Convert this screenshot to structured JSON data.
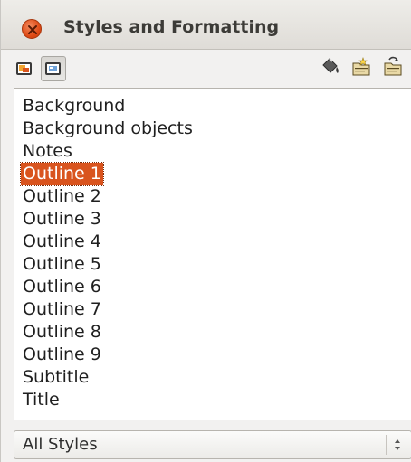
{
  "window": {
    "title": "Styles and Formatting"
  },
  "toolbar": {
    "left_buttons": [
      {
        "icon": "graphics-styles-icon",
        "pressed": false
      },
      {
        "icon": "presentation-styles-icon",
        "pressed": true
      }
    ],
    "right_buttons": [
      {
        "icon": "fill-format-mode-icon"
      },
      {
        "icon": "new-style-from-selection-icon"
      },
      {
        "icon": "update-style-icon"
      }
    ]
  },
  "styles_list": {
    "items": [
      {
        "label": "Background",
        "selected": false
      },
      {
        "label": "Background objects",
        "selected": false
      },
      {
        "label": "Notes",
        "selected": false
      },
      {
        "label": "Outline 1",
        "selected": true
      },
      {
        "label": "Outline 2",
        "selected": false
      },
      {
        "label": "Outline 3",
        "selected": false
      },
      {
        "label": "Outline 4",
        "selected": false
      },
      {
        "label": "Outline 5",
        "selected": false
      },
      {
        "label": "Outline 6",
        "selected": false
      },
      {
        "label": "Outline 7",
        "selected": false
      },
      {
        "label": "Outline 8",
        "selected": false
      },
      {
        "label": "Outline 9",
        "selected": false
      },
      {
        "label": "Subtitle",
        "selected": false
      },
      {
        "label": "Title",
        "selected": false
      }
    ]
  },
  "filter": {
    "selected": "All Styles"
  },
  "colors": {
    "selection": "#d9541e",
    "close_button": "#df4b16"
  }
}
